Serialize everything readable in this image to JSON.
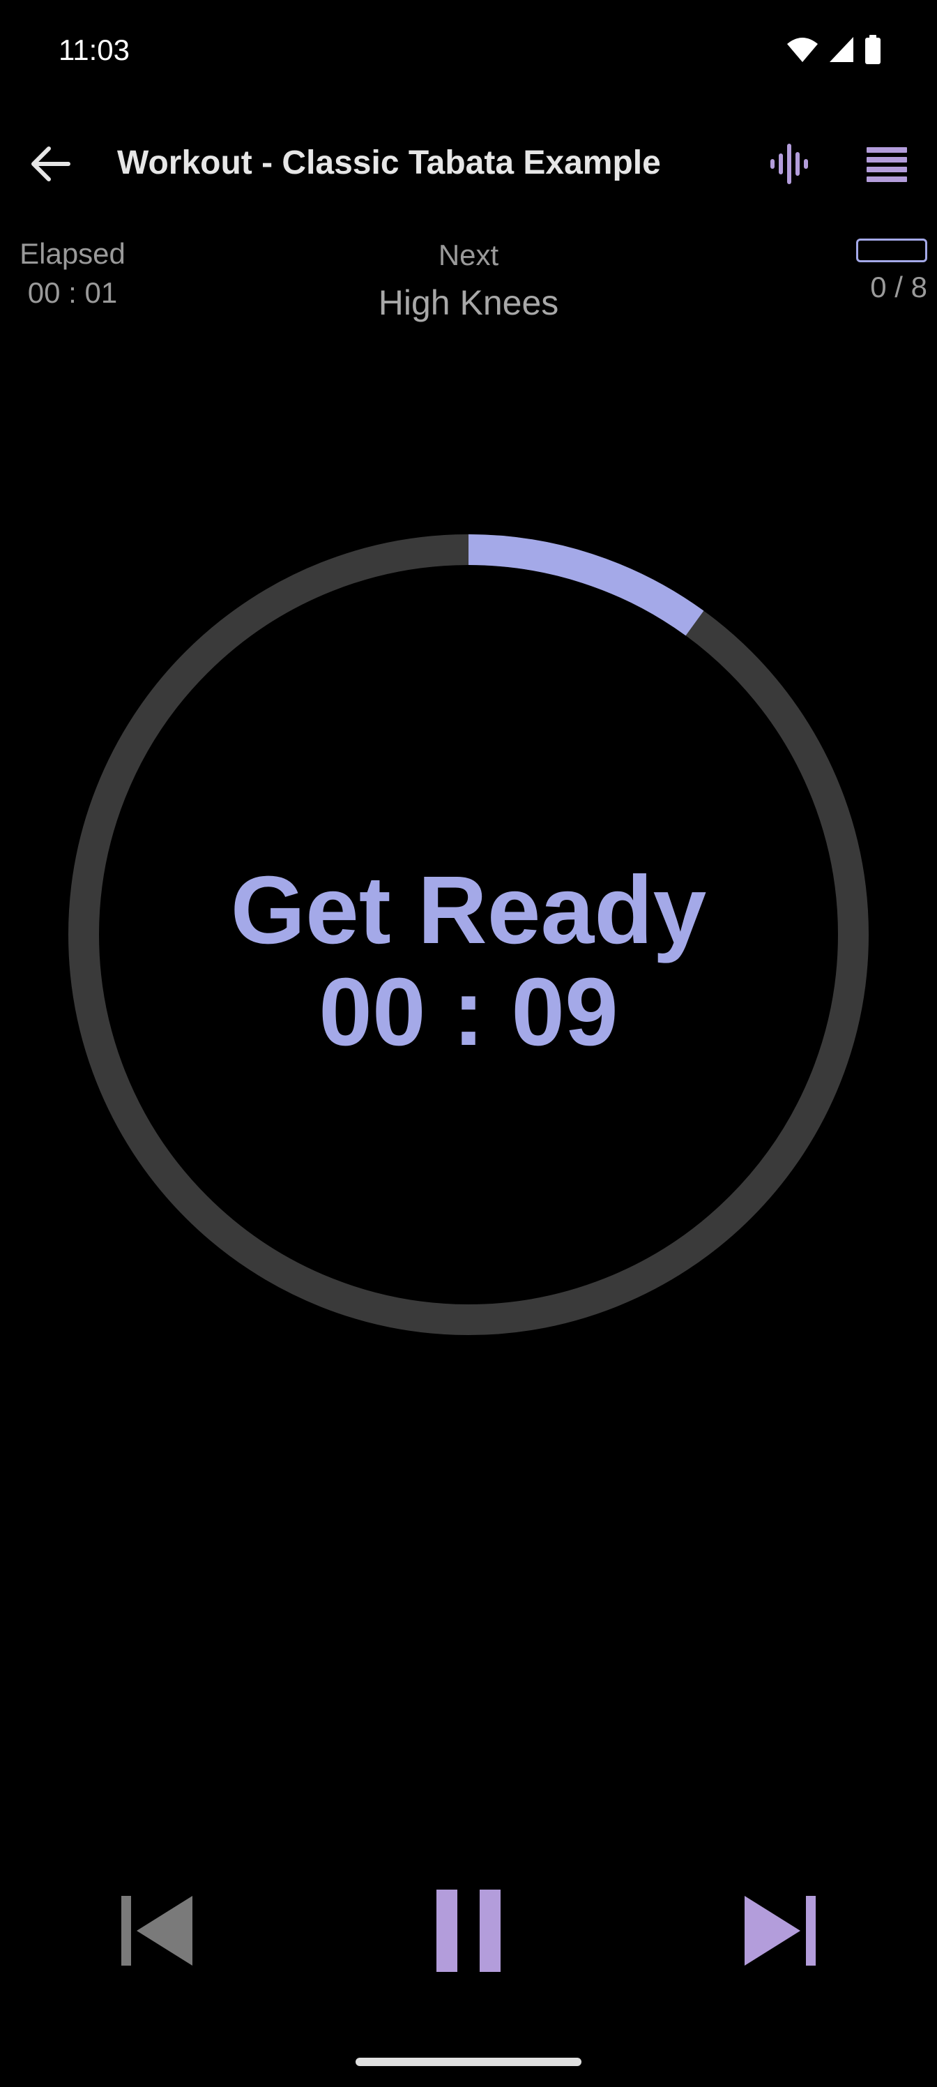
{
  "status_bar": {
    "time": "11:03",
    "icons": [
      "wifi-icon",
      "cell-signal-icon",
      "battery-icon"
    ]
  },
  "app_bar": {
    "back_icon": "arrow-left-icon",
    "title": "Workout - Classic Tabata Example",
    "sound_icon": "waveform-icon",
    "menu_icon": "list-icon"
  },
  "info": {
    "elapsed_label": "Elapsed",
    "elapsed_value": "00 : 01",
    "next_label": "Next",
    "next_value": "High Knees",
    "progress_text": "0 / 8",
    "progress_fraction": 0
  },
  "timer": {
    "phase": "Get Ready",
    "remaining": "00 : 09",
    "ring_progress": 0.1
  },
  "controls": {
    "prev_icon": "skip-previous-icon",
    "pause_icon": "pause-icon",
    "next_icon": "skip-next-icon"
  },
  "colors": {
    "accent": "#a4a9e8",
    "accent_purple": "#b39ddb",
    "ring_track": "#3a3a3a",
    "background": "#000000",
    "muted_text": "#9a9a9a"
  }
}
